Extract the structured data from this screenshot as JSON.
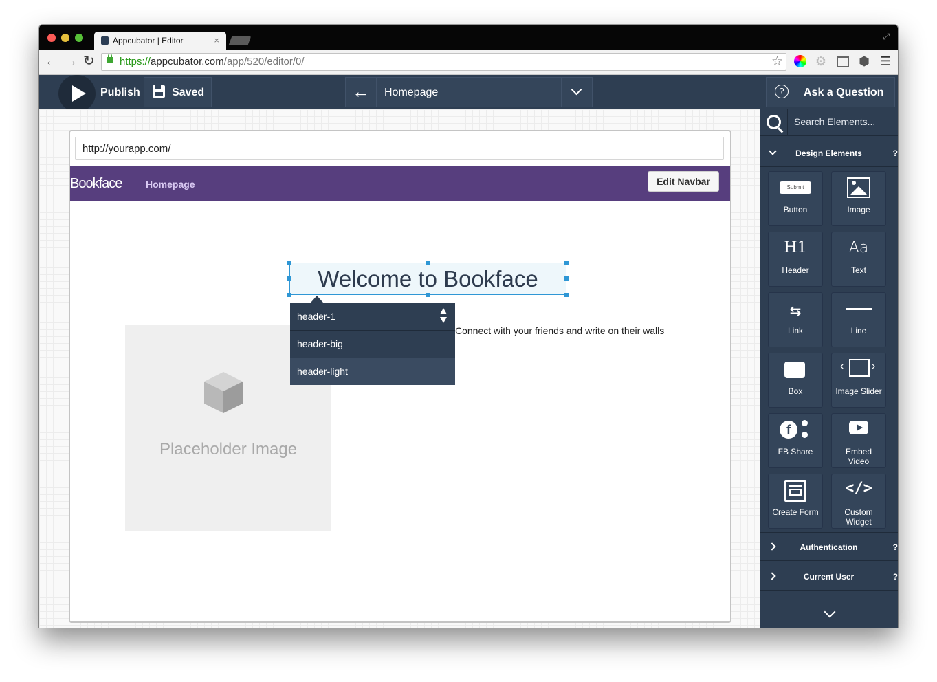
{
  "browser": {
    "tab_title": "Appcubator | Editor",
    "tab_close": "×",
    "url_scheme": "https://",
    "url_host": "appcubator.com",
    "url_path": "/app/520/editor/0/"
  },
  "header": {
    "publish_label": "Publish",
    "saved_label": "Saved",
    "page_name": "Homepage",
    "help_label": "Ask a Question",
    "help_icon": "?"
  },
  "preview": {
    "url": "http://yourapp.com/",
    "brand": "Bookface",
    "nav_link": "Homepage",
    "edit_navbar_label": "Edit Navbar",
    "heading": "Welcome to Bookface",
    "tagline": "Connect with your friends and write on their walls",
    "placeholder_label": "Placeholder Image",
    "class_options": [
      "header-1",
      "header-big",
      "header-light"
    ],
    "selected_class": "header-1",
    "highlighted_class": "header-light"
  },
  "sidebar": {
    "search_placeholder": "Search Elements...",
    "design_section": "Design Elements",
    "section_help": "?",
    "tiles": [
      {
        "label": "Button",
        "icon": "submit-button-icon",
        "icon_text": "Submit"
      },
      {
        "label": "Image",
        "icon": "image-icon"
      },
      {
        "label": "Header",
        "icon": "header-icon",
        "icon_text": "H1"
      },
      {
        "label": "Text",
        "icon": "text-icon",
        "icon_text": "Aa"
      },
      {
        "label": "Link",
        "icon": "link-icon",
        "icon_text": "⇆"
      },
      {
        "label": "Line",
        "icon": "line-icon"
      },
      {
        "label": "Box",
        "icon": "box-icon"
      },
      {
        "label": "Image Slider",
        "icon": "image-slider-icon",
        "icon_left": "‹",
        "icon_right": "›"
      },
      {
        "label": "FB Share",
        "icon": "fb-share-icon",
        "icon_text": "f"
      },
      {
        "label": "Embed Video",
        "icon": "video-icon"
      },
      {
        "label": "Create Form",
        "icon": "form-icon"
      },
      {
        "label": "Custom Widget",
        "icon": "code-icon",
        "icon_text": "</>"
      }
    ],
    "auth_section": "Authentication",
    "user_section": "Current User"
  },
  "colors": {
    "app_dark": "#2e3e52",
    "navbar_purple": "#573e7e",
    "selection_blue": "#2f97d5"
  }
}
